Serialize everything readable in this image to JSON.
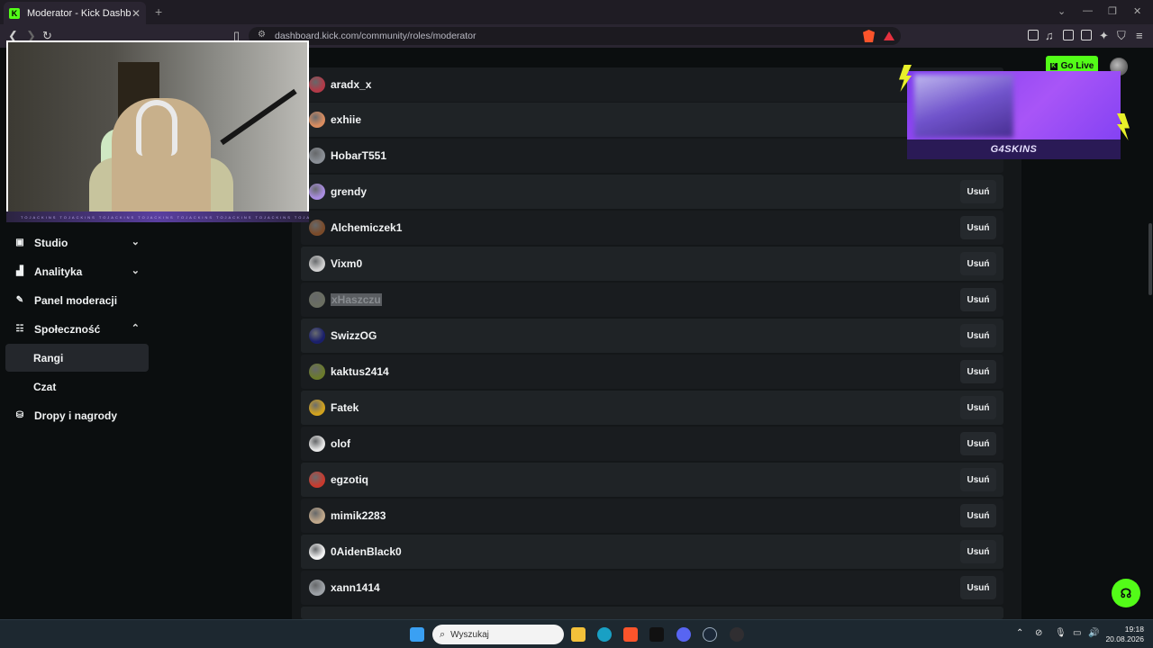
{
  "browser": {
    "tab_title": "Moderator - Kick Dashboard",
    "tab_close": "✕",
    "new_tab": "+",
    "url": "dashboard.kick.com/community/roles/moderator",
    "icons": [
      "back-icon",
      "forward-icon",
      "reload-icon",
      "bookmark-icon",
      "site-info-icon",
      "brave-shields-icon",
      "brave-rewards-icon",
      "extensions-icon",
      "media-icon",
      "sidebar-icon",
      "wallet-icon",
      "leo-ai-icon",
      "vpn-icon",
      "menu-icon"
    ]
  },
  "header": {
    "go_live": "Go Live"
  },
  "sidebar": {
    "items": [
      {
        "label": "Studio",
        "icon": "studio-icon",
        "chevron": "down"
      },
      {
        "label": "Analityka",
        "icon": "analytics-icon",
        "chevron": "down"
      },
      {
        "label": "Panel moderacji",
        "icon": "wrench-icon"
      },
      {
        "label": "Społeczność",
        "icon": "community-icon",
        "chevron": "up"
      },
      {
        "label": "Rangi",
        "active": true
      },
      {
        "label": "Czat"
      },
      {
        "label": "Dropy i nagrody",
        "icon": "drops-icon"
      }
    ]
  },
  "moderators": {
    "remove_label": "Usuń",
    "rows": [
      {
        "name": "aradx_x",
        "avatar_color": "#b23a48"
      },
      {
        "name": "exhiie",
        "avatar_color": "#d98c5f"
      },
      {
        "name": "HobarT551",
        "avatar_color": "#8a8f96"
      },
      {
        "name": "grendy",
        "avatar_color": "#a98de0"
      },
      {
        "name": "Alchemiczek1",
        "avatar_color": "#7a4b2a"
      },
      {
        "name": "Vixm0",
        "avatar_color": "#cfcfcf"
      },
      {
        "name": "xHaszczu",
        "avatar_color": "#6a6e61",
        "selected": true
      },
      {
        "name": "SwizzOG",
        "avatar_color": "#1a1f6b"
      },
      {
        "name": "kaktus2414",
        "avatar_color": "#6b7b2c"
      },
      {
        "name": "Fatek",
        "avatar_color": "#d1a21e"
      },
      {
        "name": "olof",
        "avatar_color": "#e6e6e6"
      },
      {
        "name": "egzotiq",
        "avatar_color": "#c83a2e"
      },
      {
        "name": "mimik2283",
        "avatar_color": "#bfa78a"
      },
      {
        "name": "0AidenBlack0",
        "avatar_color": "#f2f2f2"
      },
      {
        "name": "xann1414",
        "avatar_color": "#9ea3a8"
      }
    ]
  },
  "overlay": {
    "promo_brand": "G4SKINS",
    "cam_strip": "TOJACKINS   TOJACKINS   TOJACKINS   TOJACKINS   TOJACKINS   TOJACKINS   TOJACKINS   TOJACKINS"
  },
  "taskbar": {
    "search_placeholder": "Wyszukaj",
    "time": "19:18",
    "date": "20.08.2026",
    "apps": [
      "windows-start-icon",
      "file-explorer-icon",
      "edge-icon",
      "brave-icon",
      "editor-icon",
      "discord-icon",
      "steam-icon",
      "obs-icon"
    ]
  },
  "colors": {
    "accent": "#53fc18",
    "background": "#0b0e0f",
    "row": "#1f2326"
  }
}
